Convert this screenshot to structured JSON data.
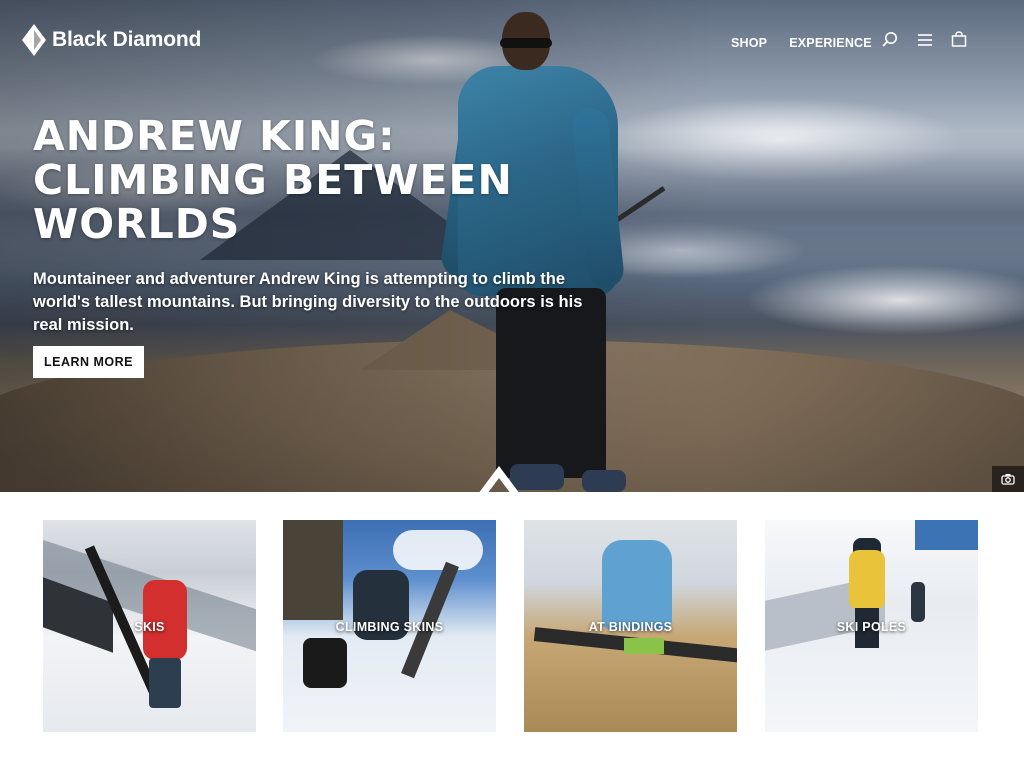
{
  "brand": {
    "name": "Black Diamond"
  },
  "nav": {
    "links": [
      "SHOP",
      "EXPERIENCE"
    ],
    "icons": [
      "search-icon",
      "menu-icon",
      "bag-icon"
    ]
  },
  "hero": {
    "title_lines": [
      "ANDREW KING:",
      "CLIMBING BETWEEN",
      "WORLDS"
    ],
    "subtitle": "Mountaineer and adventurer Andrew King is attempting to climb the world's tallest mountains. But bringing diversity to the outdoors is his real mission.",
    "cta_label": "LEARN MORE",
    "photo_credit_icon": "camera-icon"
  },
  "categories": [
    {
      "label": "SKIS"
    },
    {
      "label": "CLIMBING SKINS"
    },
    {
      "label": "AT BINDINGS"
    },
    {
      "label": "SKI POLES"
    }
  ],
  "colors": {
    "brand_text": "#ffffff",
    "button_bg": "#ffffff",
    "button_text": "#111111"
  }
}
